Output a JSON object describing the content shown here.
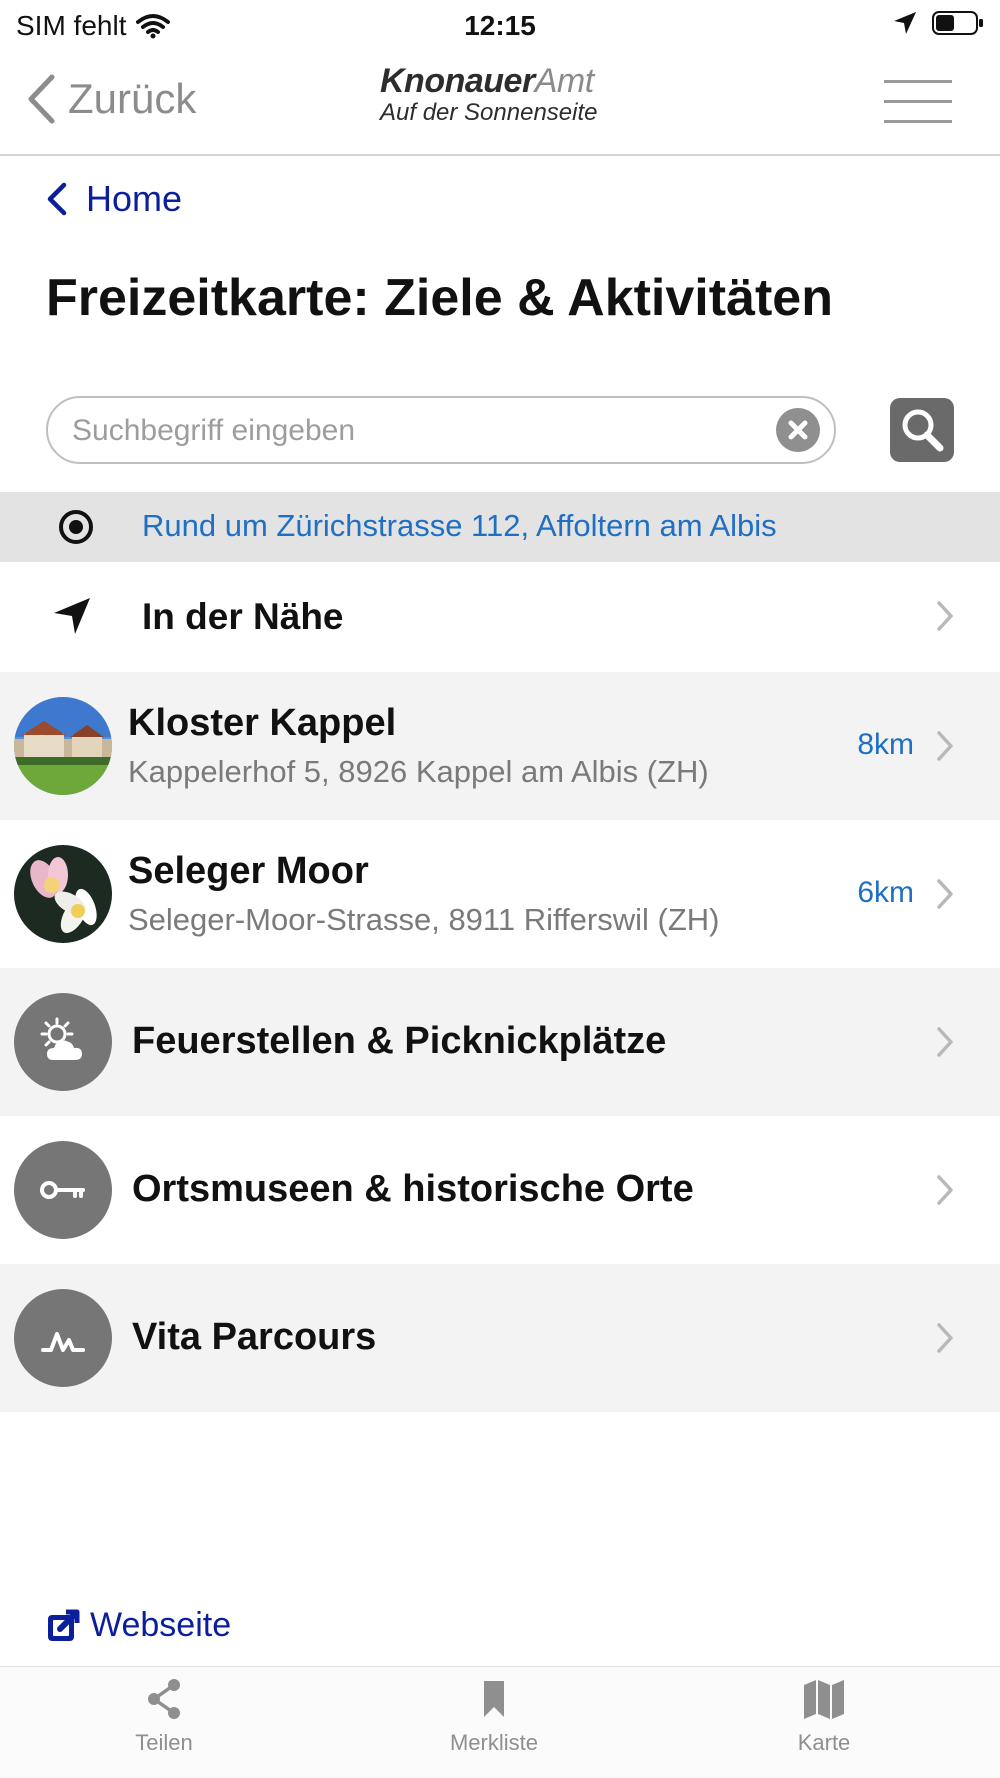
{
  "status_bar": {
    "carrier": "SIM fehlt",
    "time": "12:15"
  },
  "nav": {
    "back_label": "Zurück",
    "logo_brand": "Knonauer",
    "logo_brand_suffix": "Amt",
    "logo_tagline": "Auf der Sonnenseite"
  },
  "breadcrumb": {
    "label": "Home"
  },
  "page_title": "Freizeitkarte: Ziele & Aktivitäten",
  "search": {
    "value": "",
    "placeholder": "Suchbegriff eingeben"
  },
  "location": {
    "text": "Rund um Zürichstrasse 112, Affoltern am Albis"
  },
  "nearby": {
    "label": "In der Nähe"
  },
  "places": [
    {
      "title": "Kloster Kappel",
      "address": "Kappelerhof 5, 8926 Kappel am Albis (ZH)",
      "distance": "8km"
    },
    {
      "title": "Seleger Moor",
      "address": "Seleger-Moor-Strasse, 8911 Rifferswil (ZH)",
      "distance": "6km"
    }
  ],
  "categories": [
    {
      "label": "Feuerstellen & Picknickplätze",
      "icon": "sun-cloud-icon"
    },
    {
      "label": "Ortsmuseen & historische Orte",
      "icon": "key-icon"
    },
    {
      "label": "Vita Parcours",
      "icon": "pulse-icon"
    }
  ],
  "footer": {
    "website_label": "Webseite",
    "tabs": [
      {
        "label": "Teilen",
        "icon": "share-icon"
      },
      {
        "label": "Merkliste",
        "icon": "bookmark-icon"
      },
      {
        "label": "Karte",
        "icon": "map-icon"
      }
    ]
  },
  "colors": {
    "link_blue": "#0b1f9c",
    "accent_blue": "#1f6fc4",
    "row_grey": "#f3f3f3",
    "icon_grey": "#767676"
  }
}
